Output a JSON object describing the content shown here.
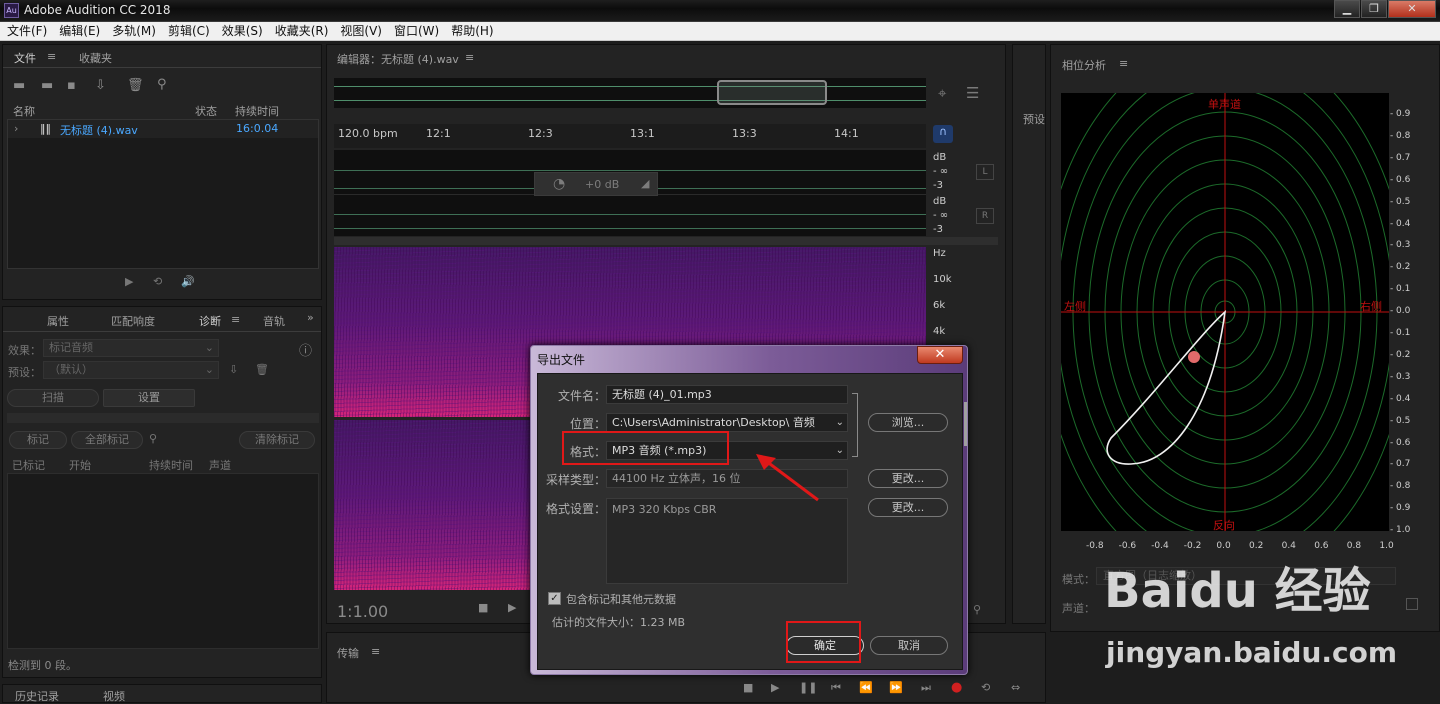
{
  "window": {
    "title": "Adobe Audition CC 2018",
    "icon_text": "Au",
    "controls": [
      "▁",
      "❐",
      "✕"
    ]
  },
  "menubar": [
    "文件(F)",
    "编辑(E)",
    "多轨(M)",
    "剪辑(C)",
    "效果(S)",
    "收藏夹(R)",
    "视图(V)",
    "窗口(W)",
    "帮助(H)"
  ],
  "files_panel": {
    "tabs": [
      "文件",
      "收藏夹"
    ],
    "col_name": "名称",
    "col_status": "状态",
    "col_duration": "持续时间",
    "file_name": "无标题 (4).wav",
    "file_duration": "16:0.04"
  },
  "props_panel": {
    "tabs": [
      "属性",
      "匹配响度",
      "诊断",
      "音轨"
    ],
    "effect_label": "效果：",
    "effect_value": "标记音频",
    "preset_label": "预设：",
    "preset_value": "（默认）",
    "scan_btn": "扫描",
    "settings_btn": "设置",
    "mark_btn": "标记",
    "mark_all_btn": "全部标记",
    "clear_btn": "清除标记",
    "cols": [
      "已标记",
      "开始",
      "持续时间",
      "声道"
    ],
    "status": "检测到 0 段。"
  },
  "bottom_left_tabs": [
    "历史记录",
    "视频"
  ],
  "editor": {
    "title": "编辑器：无标题 (4).wav",
    "bpm": "120.0 bpm",
    "ruler": [
      "12:1",
      "12:3",
      "13:1",
      "13:3",
      "14:1"
    ],
    "volume": "+0 dB",
    "db_labels": [
      "dB",
      "- ∞",
      "-3",
      "dB",
      "- ∞",
      "-3"
    ],
    "ch_left": "L",
    "ch_right": "R",
    "hz_labels": [
      "Hz",
      "10k",
      "6k",
      "4k"
    ],
    "time": "1:1.00"
  },
  "transport_panel": {
    "title": "传输"
  },
  "preset_tab": "预设",
  "dialog": {
    "title": "导出文件",
    "filename_label": "文件名：",
    "filename": "无标题 (4)_01.mp3",
    "location_label": "位置：",
    "location": "C:\\Users\\Administrator\\Desktop\\ 音频",
    "browse": "浏览...",
    "format_label": "格式：",
    "format": "MP3 音频 (*.mp3)",
    "sample_label": "采样类型：",
    "sample": "44100 Hz 立体声，16 位",
    "change": "更改...",
    "fmt_settings_label": "格式设置：",
    "fmt_settings": "MP3 320 Kbps CBR",
    "include_meta": "包含标记和其他元数据",
    "est_size": "估计的文件大小：1.23 MB",
    "ok": "确定",
    "cancel": "取消",
    "highlight_color": "#e01818"
  },
  "phase_panel": {
    "title": "相位分析",
    "top_label": "单声道",
    "bottom_label": "反向",
    "left_label": "左侧",
    "right_label": "右侧",
    "y_ticks": [
      "0.9",
      "0.8",
      "0.7",
      "0.6",
      "0.5",
      "0.4",
      "0.3",
      "0.2",
      "0.1",
      "0.0",
      "0.1",
      "0.2",
      "0.3",
      "0.4",
      "0.5",
      "0.6",
      "0.7",
      "0.8",
      "0.9",
      "1.0"
    ],
    "x_ticks": [
      "-0.8",
      "-0.6",
      "-0.4",
      "-0.2",
      "0.0",
      "0.2",
      "0.4",
      "0.6",
      "0.8",
      "1.0"
    ],
    "mode_label": "模式：",
    "mode_value": "直方图（日志缩放）",
    "channel_label": "声道："
  },
  "watermark": {
    "brand": "Baidu 经验",
    "url": "jingyan.baidu.com"
  }
}
